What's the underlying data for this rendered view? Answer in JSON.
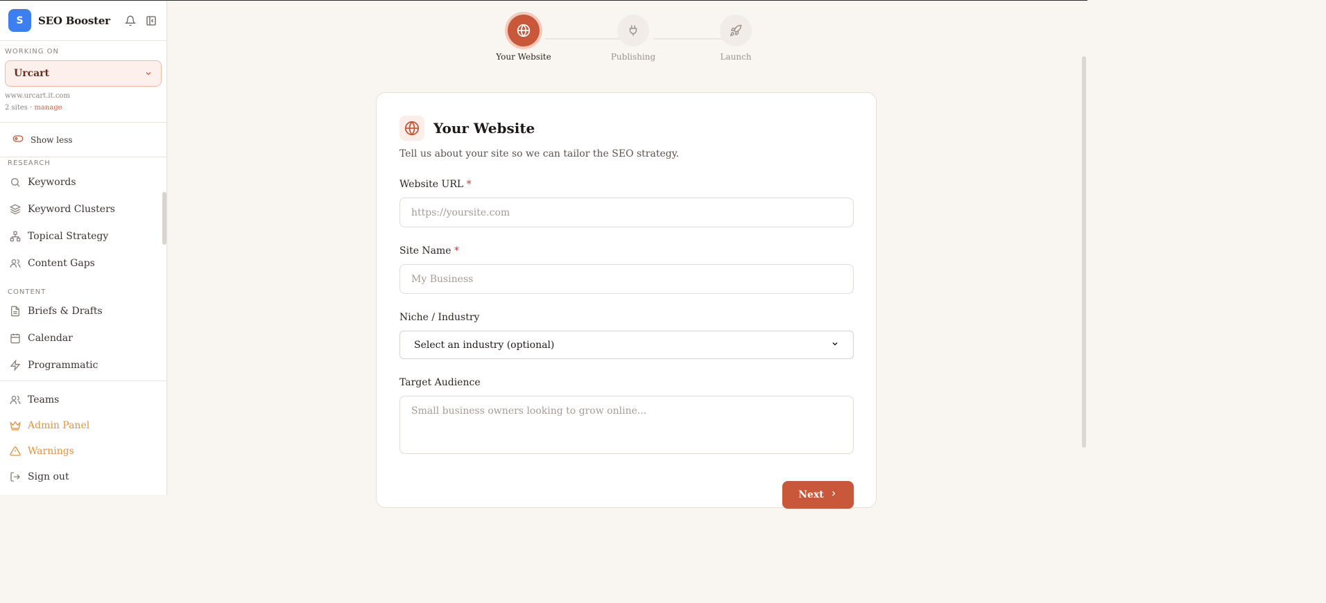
{
  "sidebar": {
    "brand": {
      "logo_letter": "S",
      "name": "SEO Booster"
    },
    "working_on": {
      "label": "WORKING ON",
      "site_name": "Urcart",
      "site_url": "www.urcart.it.com",
      "site_count": "2 sites · ",
      "manage": "manage"
    },
    "show_less": "Show less",
    "groups": [
      {
        "label": "RESEARCH",
        "items": [
          "Keywords",
          "Keyword Clusters",
          "Topical Strategy",
          "Content Gaps"
        ]
      },
      {
        "label": "CONTENT",
        "items": [
          "Briefs & Drafts",
          "Calendar",
          "Programmatic"
        ]
      }
    ],
    "bottom": [
      "Teams",
      "Admin Panel",
      "Warnings",
      "Sign out"
    ]
  },
  "steps": [
    {
      "label": "Your Website",
      "icon": "globe-icon",
      "active": true
    },
    {
      "label": "Publishing",
      "icon": "plug-icon",
      "active": false
    },
    {
      "label": "Launch",
      "icon": "rocket-icon",
      "active": false
    }
  ],
  "form": {
    "title": "Your Website",
    "subtitle": "Tell us about your site so we can tailor the SEO strategy.",
    "url_label": "Website URL",
    "url_placeholder": "https://yoursite.com",
    "name_label": "Site Name",
    "name_placeholder": "My Business",
    "niche_label": "Niche / Industry",
    "niche_value": "Select an industry (optional)",
    "audience_label": "Target Audience",
    "audience_placeholder": "Small business owners looking to grow online...",
    "required_mark": "*",
    "next": "Next"
  },
  "colors": {
    "accent": "#c9573a",
    "brand_blue": "#3b7ff0",
    "warning": "#e8913a"
  }
}
